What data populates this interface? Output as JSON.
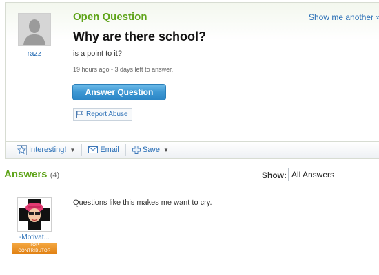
{
  "question": {
    "label": "Open Question",
    "show_another": "Show me another »",
    "title": "Why are there school?",
    "body": "is a point to it?",
    "meta": "19 hours ago - 3 days left to answer.",
    "asker": {
      "name": "razz",
      "avatar_icon": "default-silhouette-avatar"
    },
    "answer_button": "Answer Question",
    "report_button": "Report Abuse"
  },
  "toolbar": {
    "interesting": "Interesting!",
    "email": "Email",
    "save": "Save"
  },
  "answers": {
    "heading": "Answers",
    "count": "(4)",
    "show_label": "Show:",
    "filter_value": "All Answers",
    "items": [
      {
        "author": "-Motivat...",
        "badge_line1": "TOP",
        "badge_line2": "CONTRIBUTOR",
        "text": "Questions like this makes me want to cry."
      }
    ]
  },
  "colors": {
    "accent_green": "#5fa41a",
    "link_blue": "#2a6fb6",
    "button_blue": "#3d97d3",
    "badge_orange": "#f09a2a"
  }
}
